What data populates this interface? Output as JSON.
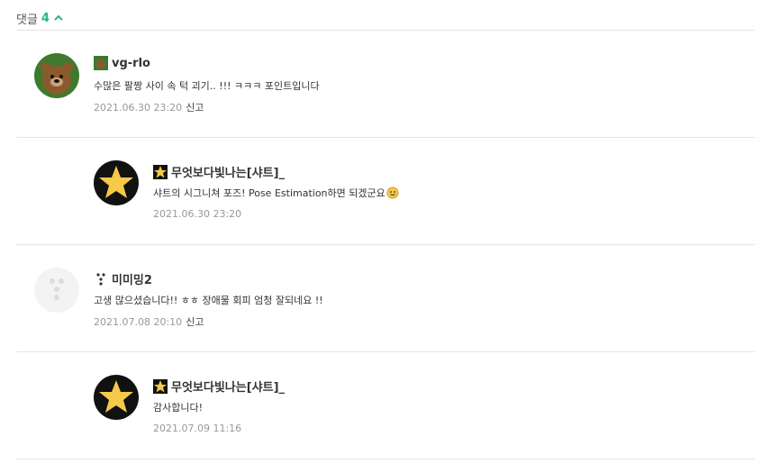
{
  "header": {
    "label": "댓글",
    "count": "4",
    "toggle_icon": "chevron-up-icon",
    "accent": "#2bb38a"
  },
  "comments": [
    {
      "author": "vg-rlo",
      "text": "수많은 팔짱 사이 속 턱 괴기.. !!! ㅋㅋㅋ 포인트입니다",
      "date": "2021.06.30 23:20",
      "report": "신고",
      "avatar": "bear-avatar"
    },
    {
      "author": "무엇보다빛나는[샤트]_",
      "text": "샤트의 시그니쳐 포즈! Pose Estimation하면 되겠군요",
      "date": "2021.06.30 23:20",
      "avatar": "star-avatar"
    },
    {
      "author": "미미밍2",
      "text": "고생 많으셨습니다!! ㅎㅎ 장애물 회피 엄청 잘되네요 !!",
      "date": "2021.07.08 20:10",
      "report": "신고",
      "avatar": "default-avatar"
    },
    {
      "author": "무엇보다빛나는[샤트]_",
      "text": "감사합니다!",
      "date": "2021.07.09 11:16",
      "avatar": "star-avatar"
    }
  ]
}
